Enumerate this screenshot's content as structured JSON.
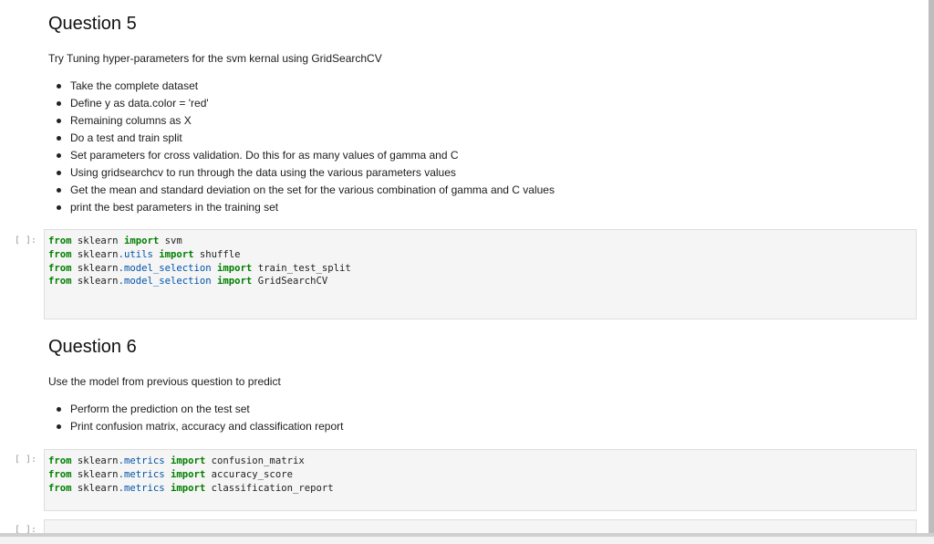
{
  "q5": {
    "heading": "Question 5",
    "intro": "Try Tuning hyper-parameters for the svm kernal using GridSearchCV",
    "bullets": [
      "Take the complete dataset",
      "Define y as data.color = 'red'",
      "Remaining columns as X",
      "Do a test and train split",
      "Set parameters for cross validation. Do this for as many values of gamma and C",
      "Using gridsearchcv to run through the data using the various parameters values",
      "Get the mean and standard deviation on the set for the various combination of gamma and C values",
      "print the best parameters in the training set"
    ]
  },
  "cell1": {
    "prompt": "[ ]:",
    "lines": [
      {
        "kw1": "from",
        "mod": "sklearn",
        "sub": "",
        "kw2": "import",
        "name": "svm"
      },
      {
        "kw1": "from",
        "mod": "sklearn",
        "sub": ".utils",
        "kw2": "import",
        "name": "shuffle"
      },
      {
        "kw1": "from",
        "mod": "sklearn",
        "sub": ".model_selection",
        "kw2": "import",
        "name": "train_test_split"
      },
      {
        "kw1": "from",
        "mod": "sklearn",
        "sub": ".model_selection",
        "kw2": "import",
        "name": "GridSearchCV"
      }
    ]
  },
  "q6": {
    "heading": "Question 6",
    "intro": "Use the model from previous question to predict",
    "bullets": [
      "Perform the prediction on the test set",
      "Print confusion matrix, accuracy and classification report"
    ]
  },
  "cell2": {
    "prompt": "[ ]:",
    "lines": [
      {
        "kw1": "from",
        "mod": "sklearn",
        "sub": ".metrics",
        "kw2": "import",
        "name": "confusion_matrix"
      },
      {
        "kw1": "from",
        "mod": "sklearn",
        "sub": ".metrics",
        "kw2": "import",
        "name": "accuracy_score"
      },
      {
        "kw1": "from",
        "mod": "sklearn",
        "sub": ".metrics",
        "kw2": "import",
        "name": "classification_report"
      }
    ]
  },
  "cell3": {
    "prompt": "[ ]:"
  }
}
